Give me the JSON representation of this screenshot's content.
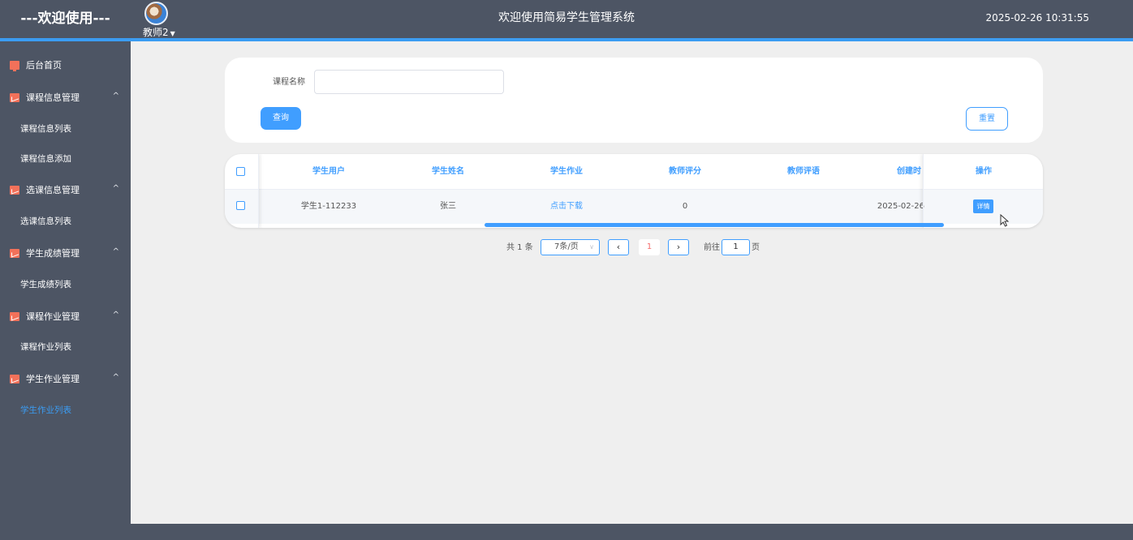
{
  "header": {
    "brand": "---欢迎使用---",
    "user_name": "教师2",
    "system_title": "欢迎使用简易学生管理系统",
    "datetime": "2025-02-26 10:31:55"
  },
  "sidebar": {
    "home": "后台首页",
    "groups": [
      {
        "label": "课程信息管理",
        "items": [
          "课程信息列表",
          "课程信息添加"
        ]
      },
      {
        "label": "选课信息管理",
        "items": [
          "选课信息列表"
        ]
      },
      {
        "label": "学生成绩管理",
        "items": [
          "学生成绩列表"
        ]
      },
      {
        "label": "课程作业管理",
        "items": [
          "课程作业列表"
        ]
      },
      {
        "label": "学生作业管理",
        "items": [
          "学生作业列表"
        ]
      }
    ],
    "active_item": "学生作业列表"
  },
  "search": {
    "label": "课程名称",
    "value": "",
    "query_button": "查询",
    "reset_button": "重置"
  },
  "table": {
    "columns": [
      "学生用户",
      "学生姓名",
      "学生作业",
      "教师评分",
      "教师评语",
      "创建时",
      "操作"
    ],
    "rows": [
      {
        "student_user": "学生1-112233",
        "student_name": "张三",
        "homework": "点击下载",
        "score": "0",
        "comment": "",
        "created": "2025-02-26",
        "action": "详情"
      }
    ]
  },
  "pagination": {
    "total": "共 1 条",
    "page_size": "7条/页",
    "current_page": "1",
    "goto_label": "前往",
    "goto_value": "1",
    "page_unit": "页"
  },
  "colors": {
    "primary": "#409eff",
    "sidebar_bg": "#4d5564",
    "accent_line": "#3b9cf2",
    "icon": "#f2715a"
  }
}
